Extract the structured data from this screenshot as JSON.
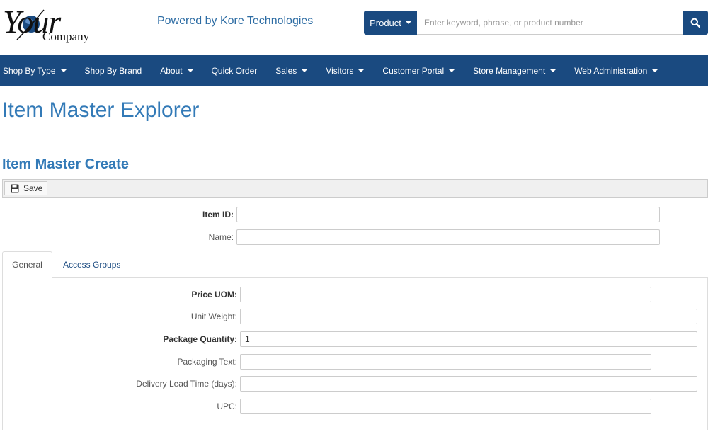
{
  "header": {
    "logo_main": "Your",
    "logo_sub": "Company",
    "powered_by": "Powered by Kore Technologies"
  },
  "search": {
    "scope_label": "Product",
    "placeholder": "Enter keyword, phrase, or product number",
    "icon": "search-icon"
  },
  "nav": {
    "items": [
      {
        "label": "Shop By Type",
        "dropdown": true
      },
      {
        "label": "Shop By Brand",
        "dropdown": false
      },
      {
        "label": "About",
        "dropdown": true
      },
      {
        "label": "Quick Order",
        "dropdown": false
      },
      {
        "label": "Sales",
        "dropdown": true
      },
      {
        "label": "Visitors",
        "dropdown": true
      },
      {
        "label": "Customer Portal",
        "dropdown": true
      },
      {
        "label": "Store Management",
        "dropdown": true
      },
      {
        "label": "Web Administration",
        "dropdown": true
      }
    ]
  },
  "page": {
    "title": "Item Master Explorer",
    "section_title": "Item Master Create"
  },
  "toolbar": {
    "save_label": "Save",
    "save_icon": "floppy-disk-icon"
  },
  "form": {
    "item_id_label": "Item ID:",
    "item_id_value": "",
    "name_label": "Name:",
    "name_value": ""
  },
  "tabs": {
    "general": "General",
    "access_groups": "Access Groups"
  },
  "general": {
    "price_uom_label": "Price UOM:",
    "price_uom_value": "",
    "unit_weight_label": "Unit Weight:",
    "unit_weight_value": "",
    "package_quantity_label": "Package Quantity:",
    "package_quantity_value": "1",
    "packaging_text_label": "Packaging Text:",
    "packaging_text_value": "",
    "delivery_lead_time_label": "Delivery Lead Time (days):",
    "delivery_lead_time_value": "",
    "upc_label": "UPC:",
    "upc_value": ""
  },
  "colors": {
    "brand": "#1a4a80",
    "title": "#337ab7"
  }
}
